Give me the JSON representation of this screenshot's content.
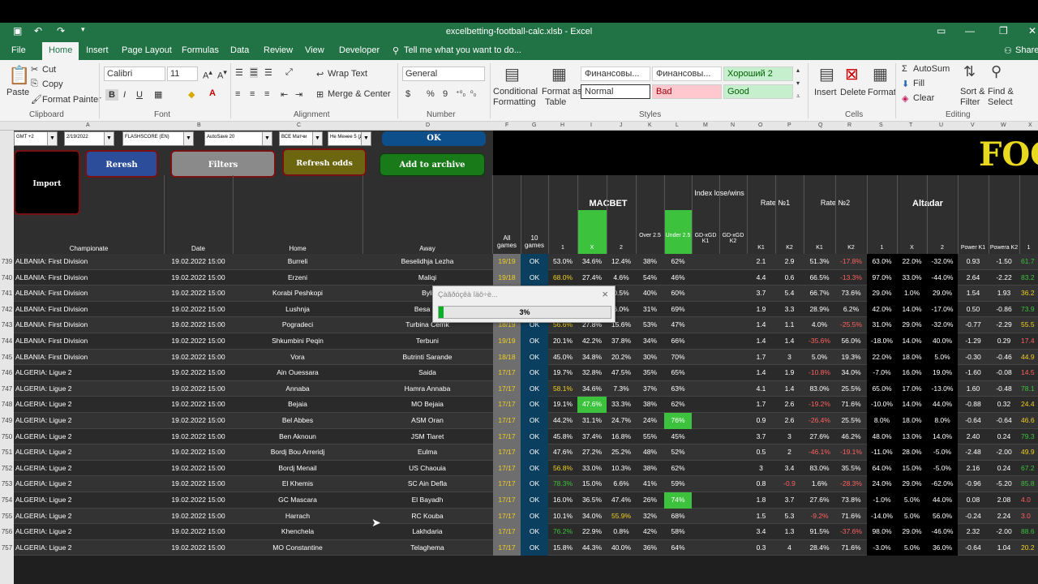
{
  "window": {
    "title": "excelbetting-football-calc.xlsb - Excel"
  },
  "menu": {
    "tabs": [
      "File",
      "Home",
      "Insert",
      "Page Layout",
      "Formulas",
      "Data",
      "Review",
      "View",
      "Developer"
    ],
    "tell_me": "Tell me what you want to do...",
    "share": "Share"
  },
  "ribbon": {
    "clipboard": {
      "paste": "Paste",
      "cut": "Cut",
      "copy": "Copy",
      "format_painter": "Format Painter",
      "label": "Clipboard"
    },
    "font": {
      "name": "Calibri",
      "size": "11",
      "label": "Font",
      "bold": "B",
      "italic": "I",
      "underline": "U"
    },
    "alignment": {
      "wrap": "Wrap Text",
      "merge": "Merge & Center",
      "label": "Alignment"
    },
    "number": {
      "format": "General",
      "label": "Number",
      "currency": "$",
      "percent": "%",
      "comma": "9"
    },
    "styles": {
      "cond": "Conditional Formatting",
      "cond_l1": "Conditional",
      "cond_l2": "Formatting",
      "fmt_table_l1": "Format as",
      "fmt_table_l2": "Table",
      "label": "Styles",
      "cells": [
        "Финансовы...",
        "Финансовы...",
        "Хороший 2",
        "Normal",
        "Bad",
        "Good"
      ]
    },
    "cells": {
      "insert": "Insert",
      "delete": "Delete",
      "format": "Format",
      "label": "Cells"
    },
    "editing": {
      "autosum": "AutoSum",
      "fill": "Fill",
      "clear": "Clear",
      "sort_l1": "Sort &",
      "sort_l2": "Filter",
      "find_l1": "Find &",
      "find_l2": "Select",
      "label": "Editing"
    }
  },
  "columns": [
    "A",
    "B",
    "C",
    "D",
    "F",
    "G",
    "H",
    "I",
    "J",
    "K",
    "L",
    "M",
    "N",
    "O",
    "P",
    "Q",
    "R",
    "S",
    "T",
    "U",
    "V",
    "W",
    "X"
  ],
  "controls": {
    "tz": "GMT +2",
    "date": "2/19/2022",
    "source": "FLASHSCORE (EN)",
    "autosave": "AutoSave 20",
    "filter1": "ВСЕ Матчи",
    "filter2": "Не Менее 5 (Д"
  },
  "buttons": {
    "ok": "OK",
    "import": "Import",
    "refresh": "Reresh",
    "filters": "Filters",
    "refresh_odds": "Refresh odds",
    "archive": "Add to archive"
  },
  "banner": "FOO",
  "header": {
    "row1": "1",
    "row2": "2",
    "championate": "Championate",
    "date": "Date",
    "home": "Home",
    "away": "Away",
    "all_games": "All games",
    "ten_games": "10 games",
    "macbet": "MACBET",
    "index": "Index lose/wins",
    "rate1": "Rate №1",
    "rate2": "Rate №2",
    "altadar": "Altadar",
    "sub": [
      "1",
      "X",
      "2",
      "Over 2.5",
      "Under 2.5",
      "GD-xGD K1",
      "GD-xGD K2",
      "K1",
      "K2",
      "K1",
      "K2",
      "1",
      "X",
      "2",
      "Power K1",
      "Powera K2",
      "1"
    ]
  },
  "rows": [
    {
      "n": "739",
      "champ": "ALBANIA: First Division",
      "date": "19.02.2022 15:00",
      "home": "Burreli",
      "away": "Beselidhja Lezha",
      "all": "19/19",
      "ten": "OK",
      "m1": "53.0%",
      "mx": "34.6%",
      "m2": "12.4%",
      "ov": "38%",
      "un": "62%",
      "k1": "2.1",
      "k2": "2.9",
      "r1": "51.3%",
      "r2": "-17.8%",
      "a1": "63.0%",
      "ax": "22.0%",
      "a2": "-32.0%",
      "p1": "0.93",
      "p2": "-1.50",
      "x": "61.7"
    },
    {
      "n": "740",
      "champ": "ALBANIA: First Division",
      "date": "19.02.2022 15:00",
      "home": "Erzeni",
      "away": "Maliqi",
      "all": "19/18",
      "ten": "OK",
      "m1": "68.0%",
      "mx": "27.4%",
      "m2": "4.6%",
      "ov": "54%",
      "un": "46%",
      "k1": "4.4",
      "k2": "0.6",
      "r1": "66.5%",
      "r2": "-13.3%",
      "a1": "97.0%",
      "ax": "33.0%",
      "a2": "-44.0%",
      "p1": "2.64",
      "p2": "-2.22",
      "x": "83.2"
    },
    {
      "n": "741",
      "champ": "ALBANIA: First Division",
      "date": "19.02.2022 15:00",
      "home": "Korabi Peshkopi",
      "away": "Byli",
      "all": "19/19",
      "ten": "OK",
      "m1": "",
      "mx": "",
      "m2": "0.5%",
      "ov": "40%",
      "un": "60%",
      "k1": "3.7",
      "k2": "5.4",
      "r1": "66.7%",
      "r2": "73.6%",
      "a1": "29.0%",
      "ax": "1.0%",
      "a2": "29.0%",
      "p1": "1.54",
      "p2": "1.93",
      "x": "36.2"
    },
    {
      "n": "742",
      "champ": "ALBANIA: First Division",
      "date": "19.02.2022 15:00",
      "home": "Lushnja",
      "away": "Besa Ka",
      "all": "19/19",
      "ten": "OK",
      "m1": "",
      "mx": "",
      "m2": "6.0%",
      "ov": "31%",
      "un": "69%",
      "k1": "1.9",
      "k2": "3.3",
      "r1": "28.9%",
      "r2": "6.2%",
      "a1": "42.0%",
      "ax": "14.0%",
      "a2": "-17.0%",
      "p1": "0.50",
      "p2": "-0.86",
      "x": "73.9"
    },
    {
      "n": "743",
      "champ": "ALBANIA: First Division",
      "date": "19.02.2022 15:00",
      "home": "Pogradeci",
      "away": "Turbina Cerrik",
      "all": "18/19",
      "ten": "OK",
      "m1": "56.6%",
      "mx": "27.8%",
      "m2": "15.6%",
      "ov": "53%",
      "un": "47%",
      "k1": "1.4",
      "k2": "1.1",
      "r1": "4.0%",
      "r2": "-25.5%",
      "a1": "31.0%",
      "ax": "29.0%",
      "a2": "-32.0%",
      "p1": "-0.77",
      "p2": "-2.29",
      "x": "55.5"
    },
    {
      "n": "744",
      "champ": "ALBANIA: First Division",
      "date": "19.02.2022 15:00",
      "home": "Shkumbini Peqin",
      "away": "Terbuni",
      "all": "19/19",
      "ten": "OK",
      "m1": "20.1%",
      "mx": "42.2%",
      "m2": "37.8%",
      "ov": "34%",
      "un": "66%",
      "k1": "1.4",
      "k2": "1.4",
      "r1": "-35.6%",
      "r2": "56.0%",
      "a1": "-18.0%",
      "ax": "14.0%",
      "a2": "40.0%",
      "p1": "-1.29",
      "p2": "0.29",
      "x": "17.4"
    },
    {
      "n": "745",
      "champ": "ALBANIA: First Division",
      "date": "19.02.2022 15:00",
      "home": "Vora",
      "away": "Butrinti Sarande",
      "all": "18/18",
      "ten": "OK",
      "m1": "45.0%",
      "mx": "34.8%",
      "m2": "20.2%",
      "ov": "30%",
      "un": "70%",
      "k1": "1.7",
      "k2": "3",
      "r1": "5.0%",
      "r2": "19.3%",
      "a1": "22.0%",
      "ax": "18.0%",
      "a2": "5.0%",
      "p1": "-0.30",
      "p2": "-0.46",
      "x": "44.9"
    },
    {
      "n": "746",
      "champ": "ALGERIA: Ligue 2",
      "date": "19.02.2022 15:00",
      "home": "Ain Ouessara",
      "away": "Saida",
      "all": "17/17",
      "ten": "OK",
      "m1": "19.7%",
      "mx": "32.8%",
      "m2": "47.5%",
      "ov": "35%",
      "un": "65%",
      "k1": "1.4",
      "k2": "1.9",
      "r1": "-10.8%",
      "r2": "34.0%",
      "a1": "-7.0%",
      "ax": "16.0%",
      "a2": "19.0%",
      "p1": "-1.60",
      "p2": "-0.08",
      "x": "14.5"
    },
    {
      "n": "747",
      "champ": "ALGERIA: Ligue 2",
      "date": "19.02.2022 15:00",
      "home": "Annaba",
      "away": "Hamra Annaba",
      "all": "17/17",
      "ten": "OK",
      "m1": "58.1%",
      "mx": "34.6%",
      "m2": "7.3%",
      "ov": "37%",
      "un": "63%",
      "k1": "4.1",
      "k2": "1.4",
      "r1": "83.0%",
      "r2": "25.5%",
      "a1": "65.0%",
      "ax": "17.0%",
      "a2": "-13.0%",
      "p1": "1.60",
      "p2": "-0.48",
      "x": "78.1"
    },
    {
      "n": "748",
      "champ": "ALGERIA: Ligue 2",
      "date": "19.02.2022 15:00",
      "home": "Bejaia",
      "away": "MO Bejaia",
      "all": "17/17",
      "ten": "OK",
      "m1": "19.1%",
      "mx": "47.6%",
      "m2": "33.3%",
      "ov": "38%",
      "un": "62%",
      "k1": "1.7",
      "k2": "2.6",
      "r1": "-19.2%",
      "r2": "71.6%",
      "a1": "-10.0%",
      "ax": "14.0%",
      "a2": "44.0%",
      "p1": "-0.88",
      "p2": "0.32",
      "x": "24.4"
    },
    {
      "n": "749",
      "champ": "ALGERIA: Ligue 2",
      "date": "19.02.2022 15:00",
      "home": "Bel Abbes",
      "away": "ASM Oran",
      "all": "17/17",
      "ten": "OK",
      "m1": "44.2%",
      "mx": "31.1%",
      "m2": "24.7%",
      "ov": "24%",
      "un": "76%",
      "k1": "0.9",
      "k2": "2.6",
      "r1": "-26.4%",
      "r2": "25.5%",
      "a1": "8.0%",
      "ax": "18.0%",
      "a2": "8.0%",
      "p1": "-0.64",
      "p2": "-0.64",
      "x": "46.6"
    },
    {
      "n": "750",
      "champ": "ALGERIA: Ligue 2",
      "date": "19.02.2022 15:00",
      "home": "Ben Aknoun",
      "away": "JSM Tiaret",
      "all": "17/17",
      "ten": "OK",
      "m1": "45.8%",
      "mx": "37.4%",
      "m2": "16.8%",
      "ov": "55%",
      "un": "45%",
      "k1": "3.7",
      "k2": "3",
      "r1": "27.6%",
      "r2": "46.2%",
      "a1": "48.0%",
      "ax": "13.0%",
      "a2": "14.0%",
      "p1": "2.40",
      "p2": "0.24",
      "x": "79.3"
    },
    {
      "n": "751",
      "champ": "ALGERIA: Ligue 2",
      "date": "19.02.2022 15:00",
      "home": "Bordj Bou Arreridj",
      "away": "Eulma",
      "all": "17/17",
      "ten": "OK",
      "m1": "47.6%",
      "mx": "27.2%",
      "m2": "25.2%",
      "ov": "48%",
      "un": "52%",
      "k1": "0.5",
      "k2": "2",
      "r1": "-46.1%",
      "r2": "-19.1%",
      "a1": "-11.0%",
      "ax": "28.0%",
      "a2": "-5.0%",
      "p1": "-2.48",
      "p2": "-2.00",
      "x": "49.9"
    },
    {
      "n": "752",
      "champ": "ALGERIA: Ligue 2",
      "date": "19.02.2022 15:00",
      "home": "Bordj Menail",
      "away": "US Chaouia",
      "all": "17/17",
      "ten": "OK",
      "m1": "56.8%",
      "mx": "33.0%",
      "m2": "10.3%",
      "ov": "38%",
      "un": "62%",
      "k1": "3",
      "k2": "3.4",
      "r1": "83.0%",
      "r2": "35.5%",
      "a1": "64.0%",
      "ax": "15.0%",
      "a2": "-5.0%",
      "p1": "2.16",
      "p2": "0.24",
      "x": "67.2"
    },
    {
      "n": "753",
      "champ": "ALGERIA: Ligue 2",
      "date": "19.02.2022 15:00",
      "home": "El Khemis",
      "away": "SC Ain Defla",
      "all": "17/17",
      "ten": "OK",
      "m1": "78.3%",
      "mx": "15.0%",
      "m2": "6.6%",
      "ov": "41%",
      "un": "59%",
      "k1": "0.8",
      "k2": "-0.9",
      "r1": "1.6%",
      "r2": "-28.3%",
      "a1": "24.0%",
      "ax": "29.0%",
      "a2": "-62.0%",
      "p1": "-0.96",
      "p2": "-5.20",
      "x": "85.8"
    },
    {
      "n": "754",
      "champ": "ALGERIA: Ligue 2",
      "date": "19.02.2022 15:00",
      "home": "GC Mascara",
      "away": "El Bayadh",
      "all": "17/17",
      "ten": "OK",
      "m1": "16.0%",
      "mx": "36.5%",
      "m2": "47.4%",
      "ov": "26%",
      "un": "74%",
      "k1": "1.8",
      "k2": "3.7",
      "r1": "27.6%",
      "r2": "73.8%",
      "a1": "-1.0%",
      "ax": "5.0%",
      "a2": "44.0%",
      "p1": "0.08",
      "p2": "2.08",
      "x": "4.0"
    },
    {
      "n": "755",
      "champ": "ALGERIA: Ligue 2",
      "date": "19.02.2022 15:00",
      "home": "Harrach",
      "away": "RC Kouba",
      "all": "17/17",
      "ten": "OK",
      "m1": "10.1%",
      "mx": "34.0%",
      "m2": "55.9%",
      "ov": "32%",
      "un": "68%",
      "k1": "1.5",
      "k2": "5.3",
      "r1": "-9.2%",
      "r2": "71.6%",
      "a1": "-14.0%",
      "ax": "5.0%",
      "a2": "56.0%",
      "p1": "-0.24",
      "p2": "2.24",
      "x": "3.0"
    },
    {
      "n": "756",
      "champ": "ALGERIA: Ligue 2",
      "date": "19.02.2022 15:00",
      "home": "Khenchela",
      "away": "Lakhdaria",
      "all": "17/17",
      "ten": "OK",
      "m1": "76.2%",
      "mx": "22.9%",
      "m2": "0.8%",
      "ov": "42%",
      "un": "58%",
      "k1": "3.4",
      "k2": "1.3",
      "r1": "91.5%",
      "r2": "-37.6%",
      "a1": "98.0%",
      "ax": "29.0%",
      "a2": "-46.0%",
      "p1": "2.32",
      "p2": "-2.00",
      "x": "88.6"
    },
    {
      "n": "757",
      "champ": "ALGERIA: Ligue 2",
      "date": "19.02.2022 15:00",
      "home": "MO Constantine",
      "away": "Telaghema",
      "all": "17/17",
      "ten": "OK",
      "m1": "15.8%",
      "mx": "44.3%",
      "m2": "40.0%",
      "ov": "36%",
      "un": "64%",
      "k1": "0.3",
      "k2": "4",
      "r1": "28.4%",
      "r2": "71.6%",
      "a1": "-3.0%",
      "ax": "5.0%",
      "a2": "36.0%",
      "p1": "-0.64",
      "p2": "1.04",
      "x": "20.2"
    }
  ],
  "dialog": {
    "title": "Çàãðóçêà îäô÷è...",
    "progress": "3%",
    "close": "×",
    "progress_fraction": 0.03
  },
  "colors": {
    "excel_green": "#217346",
    "highlight_green": "#3cc23c",
    "yellow": "#f0d020",
    "red": "#ff6060",
    "ok_blue": "#0b3f60"
  }
}
